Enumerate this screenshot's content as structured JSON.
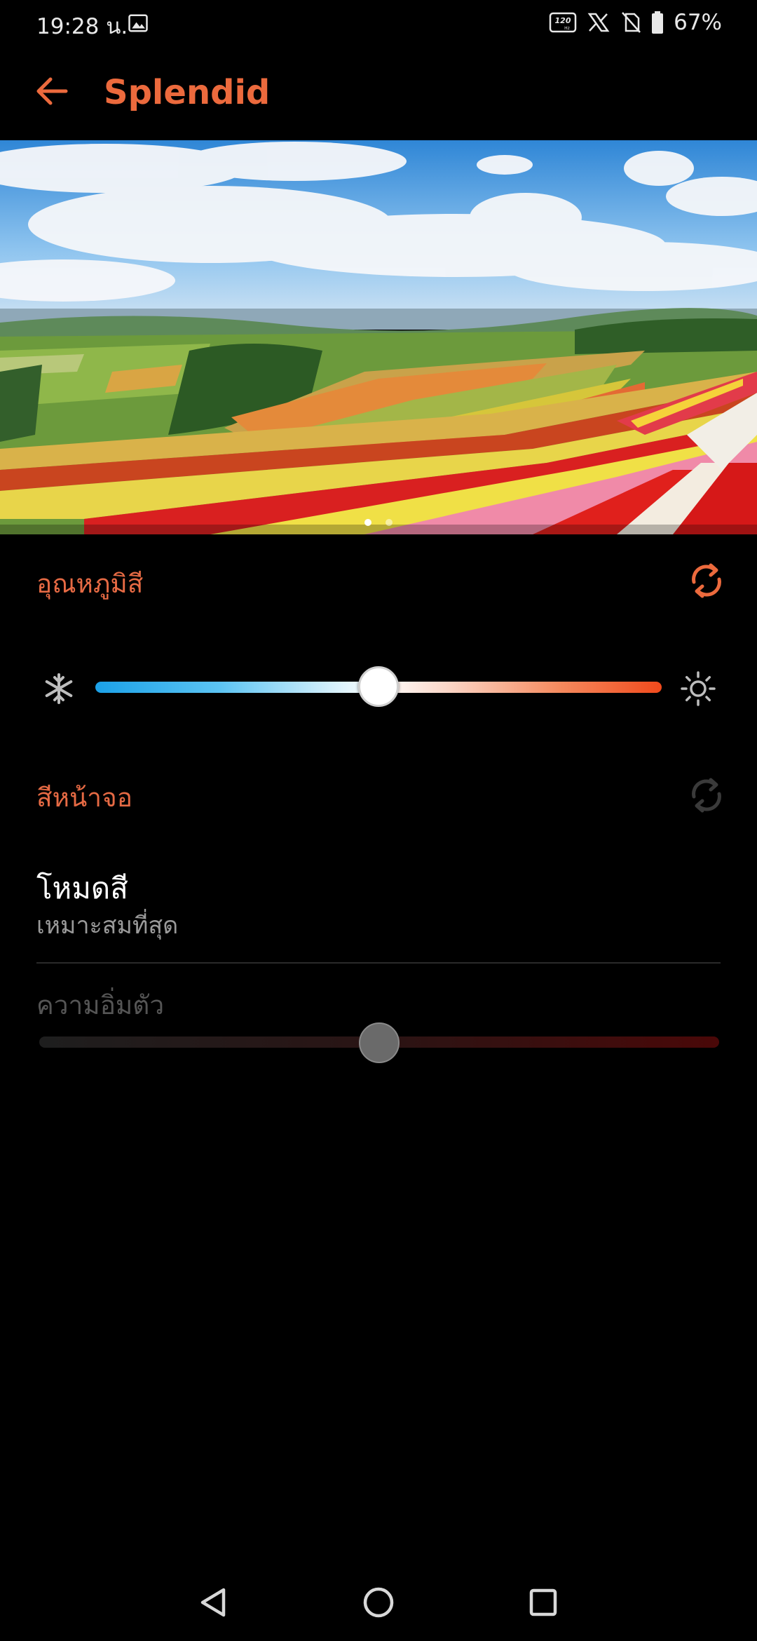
{
  "status_bar": {
    "time": "19:28 น.",
    "battery": "67%",
    "icons": [
      "gallery-icon",
      "refresh-rate-120hz-icon",
      "x-app-icon",
      "no-sim-icon",
      "battery-icon"
    ]
  },
  "header": {
    "title": "Splendid",
    "back_icon": "arrow-left-icon"
  },
  "preview": {
    "pages": 2,
    "active_page": 1
  },
  "color_temperature": {
    "title": "อุณหภูมิสี",
    "reset_icon": "refresh-icon",
    "cold_icon": "snowflake-icon",
    "warm_icon": "sun-icon",
    "level": 0.5
  },
  "screen_color": {
    "title": "สีหน้าจอ",
    "reset_icon": "refresh-icon",
    "reset_enabled": false
  },
  "color_mode": {
    "label": "โหมดสี",
    "value": "เหมาะสมที่สุด"
  },
  "saturation": {
    "label": "ความอิ่มตัว",
    "level": 0.5,
    "enabled": false
  },
  "colors": {
    "accent": "#ec6a3d",
    "background": "#000000"
  },
  "nav": {
    "back_icon": "triangle-back-icon",
    "home_icon": "circle-home-icon",
    "recents_icon": "square-recents-icon"
  }
}
